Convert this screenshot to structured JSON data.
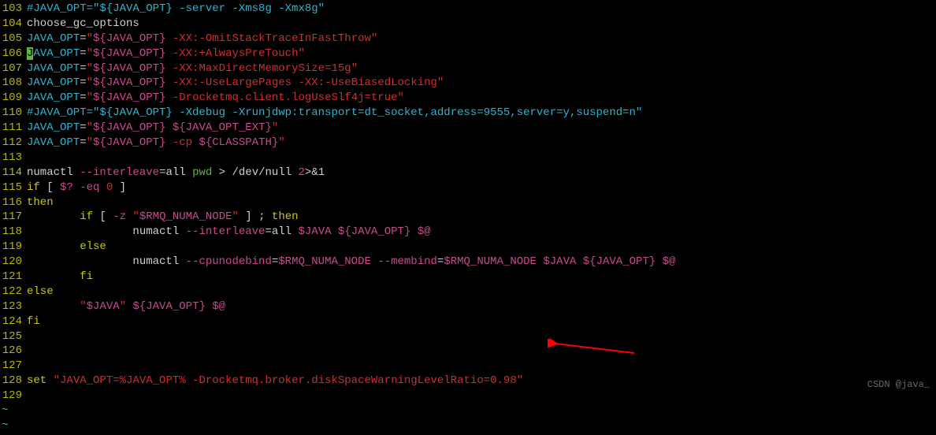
{
  "watermark": "CSDN @java_",
  "tilde": "~",
  "lines": [
    {
      "num": "103",
      "tokens": [
        {
          "t": "#JAVA_OPT=\"${JAVA_OPT} -server -Xms8g -Xmx8g\"",
          "cls": "c-comment"
        }
      ]
    },
    {
      "num": "104",
      "tokens": [
        {
          "t": "choose_gc_options",
          "cls": "c-white"
        }
      ]
    },
    {
      "num": "105",
      "tokens": [
        {
          "t": "JAVA_OPT",
          "cls": "c-cyan"
        },
        {
          "t": "=",
          "cls": "c-white"
        },
        {
          "t": "\"",
          "cls": "c-red"
        },
        {
          "t": "${JAVA_OPT}",
          "cls": "c-magenta"
        },
        {
          "t": " -XX:-OmitStackTraceInFastThrow",
          "cls": "c-red"
        },
        {
          "t": "\"",
          "cls": "c-red"
        }
      ]
    },
    {
      "num": "106",
      "tokens": [
        {
          "t": "J",
          "cls": "cursor-cell"
        },
        {
          "t": "AVA_OPT",
          "cls": "c-cyan"
        },
        {
          "t": "=",
          "cls": "c-white"
        },
        {
          "t": "\"",
          "cls": "c-red"
        },
        {
          "t": "${JAVA_OPT}",
          "cls": "c-magenta"
        },
        {
          "t": " -XX:+AlwaysPreTouch",
          "cls": "c-red"
        },
        {
          "t": "\"",
          "cls": "c-red"
        }
      ]
    },
    {
      "num": "107",
      "tokens": [
        {
          "t": "JAVA_OPT",
          "cls": "c-cyan"
        },
        {
          "t": "=",
          "cls": "c-white"
        },
        {
          "t": "\"",
          "cls": "c-red"
        },
        {
          "t": "${JAVA_OPT}",
          "cls": "c-magenta"
        },
        {
          "t": " -XX:MaxDirectMemorySize=15g",
          "cls": "c-red"
        },
        {
          "t": "\"",
          "cls": "c-red"
        }
      ]
    },
    {
      "num": "108",
      "tokens": [
        {
          "t": "JAVA_OPT",
          "cls": "c-cyan"
        },
        {
          "t": "=",
          "cls": "c-white"
        },
        {
          "t": "\"",
          "cls": "c-red"
        },
        {
          "t": "${JAVA_OPT}",
          "cls": "c-magenta"
        },
        {
          "t": " -XX:-UseLargePages -XX:-UseBiasedLocking",
          "cls": "c-red"
        },
        {
          "t": "\"",
          "cls": "c-red"
        }
      ]
    },
    {
      "num": "109",
      "tokens": [
        {
          "t": "JAVA_OPT",
          "cls": "c-cyan"
        },
        {
          "t": "=",
          "cls": "c-white"
        },
        {
          "t": "\"",
          "cls": "c-red"
        },
        {
          "t": "${JAVA_OPT}",
          "cls": "c-magenta"
        },
        {
          "t": " -Drocketmq.client.logUseSlf4j=true",
          "cls": "c-red"
        },
        {
          "t": "\"",
          "cls": "c-red"
        }
      ]
    },
    {
      "num": "110",
      "tokens": [
        {
          "t": "#JAVA_OPT=\"${JAVA_OPT} -Xdebug -Xrunjdwp:transport=dt_socket,address=9555,server=y,suspend=n\"",
          "cls": "c-comment"
        }
      ]
    },
    {
      "num": "111",
      "tokens": [
        {
          "t": "JAVA_OPT",
          "cls": "c-cyan"
        },
        {
          "t": "=",
          "cls": "c-white"
        },
        {
          "t": "\"",
          "cls": "c-red"
        },
        {
          "t": "${JAVA_OPT} ${JAVA_OPT_EXT}",
          "cls": "c-magenta"
        },
        {
          "t": "\"",
          "cls": "c-red"
        }
      ]
    },
    {
      "num": "112",
      "tokens": [
        {
          "t": "JAVA_OPT",
          "cls": "c-cyan"
        },
        {
          "t": "=",
          "cls": "c-white"
        },
        {
          "t": "\"",
          "cls": "c-red"
        },
        {
          "t": "${JAVA_OPT}",
          "cls": "c-magenta"
        },
        {
          "t": " -cp ",
          "cls": "c-red"
        },
        {
          "t": "${CLASSPATH}",
          "cls": "c-magenta"
        },
        {
          "t": "\"",
          "cls": "c-red"
        }
      ]
    },
    {
      "num": "113",
      "tokens": [
        {
          "t": "",
          "cls": "c-white"
        }
      ]
    },
    {
      "num": "114",
      "tokens": [
        {
          "t": "numactl ",
          "cls": "c-white"
        },
        {
          "t": "--interleave",
          "cls": "c-magenta"
        },
        {
          "t": "=all ",
          "cls": "c-white"
        },
        {
          "t": "pwd",
          "cls": "c-green"
        },
        {
          "t": " > ",
          "cls": "c-white"
        },
        {
          "t": "/dev/null ",
          "cls": "c-white"
        },
        {
          "t": "2",
          "cls": "c-magenta"
        },
        {
          "t": ">&",
          "cls": "c-white"
        },
        {
          "t": "1",
          "cls": "c-white"
        }
      ]
    },
    {
      "num": "115",
      "tokens": [
        {
          "t": "if",
          "cls": "c-yellow"
        },
        {
          "t": " [",
          "cls": "c-white"
        },
        {
          "t": " ",
          "cls": "c-white"
        },
        {
          "t": "$?",
          "cls": "c-magenta"
        },
        {
          "t": " ",
          "cls": "c-white"
        },
        {
          "t": "-eq",
          "cls": "c-magenta"
        },
        {
          "t": " ",
          "cls": "c-white"
        },
        {
          "t": "0",
          "cls": "c-red"
        },
        {
          "t": " ]",
          "cls": "c-white"
        }
      ]
    },
    {
      "num": "116",
      "tokens": [
        {
          "t": "then",
          "cls": "c-yellow"
        }
      ]
    },
    {
      "num": "117",
      "tokens": [
        {
          "t": "        ",
          "cls": "c-white"
        },
        {
          "t": "if",
          "cls": "c-yellow"
        },
        {
          "t": " [",
          "cls": "c-white"
        },
        {
          "t": " ",
          "cls": "c-white"
        },
        {
          "t": "-z",
          "cls": "c-magenta"
        },
        {
          "t": " ",
          "cls": "c-white"
        },
        {
          "t": "\"",
          "cls": "c-red"
        },
        {
          "t": "$RMQ_NUMA_NODE",
          "cls": "c-magenta"
        },
        {
          "t": "\"",
          "cls": "c-red"
        },
        {
          "t": " ] ; ",
          "cls": "c-white"
        },
        {
          "t": "then",
          "cls": "c-yellow"
        }
      ]
    },
    {
      "num": "118",
      "tokens": [
        {
          "t": "                numactl ",
          "cls": "c-white"
        },
        {
          "t": "--interleave",
          "cls": "c-magenta"
        },
        {
          "t": "=all ",
          "cls": "c-white"
        },
        {
          "t": "$JAVA",
          "cls": "c-magenta"
        },
        {
          "t": " ",
          "cls": "c-white"
        },
        {
          "t": "${JAVA_OPT}",
          "cls": "c-magenta"
        },
        {
          "t": " ",
          "cls": "c-white"
        },
        {
          "t": "$@",
          "cls": "c-magenta"
        }
      ]
    },
    {
      "num": "119",
      "tokens": [
        {
          "t": "        ",
          "cls": "c-white"
        },
        {
          "t": "else",
          "cls": "c-yellow"
        }
      ]
    },
    {
      "num": "120",
      "tokens": [
        {
          "t": "                numactl ",
          "cls": "c-white"
        },
        {
          "t": "--cpunodebind",
          "cls": "c-magenta"
        },
        {
          "t": "=",
          "cls": "c-white"
        },
        {
          "t": "$RMQ_NUMA_NODE",
          "cls": "c-magenta"
        },
        {
          "t": " ",
          "cls": "c-white"
        },
        {
          "t": "--membind",
          "cls": "c-magenta"
        },
        {
          "t": "=",
          "cls": "c-white"
        },
        {
          "t": "$RMQ_NUMA_NODE",
          "cls": "c-magenta"
        },
        {
          "t": " ",
          "cls": "c-white"
        },
        {
          "t": "$JAVA",
          "cls": "c-magenta"
        },
        {
          "t": " ",
          "cls": "c-white"
        },
        {
          "t": "${JAVA_OPT}",
          "cls": "c-magenta"
        },
        {
          "t": " ",
          "cls": "c-white"
        },
        {
          "t": "$@",
          "cls": "c-magenta"
        }
      ]
    },
    {
      "num": "121",
      "tokens": [
        {
          "t": "        ",
          "cls": "c-white"
        },
        {
          "t": "fi",
          "cls": "c-yellow"
        }
      ]
    },
    {
      "num": "122",
      "tokens": [
        {
          "t": "else",
          "cls": "c-yellow"
        }
      ]
    },
    {
      "num": "123",
      "tokens": [
        {
          "t": "        ",
          "cls": "c-white"
        },
        {
          "t": "\"",
          "cls": "c-red"
        },
        {
          "t": "$JAVA",
          "cls": "c-magenta"
        },
        {
          "t": "\"",
          "cls": "c-red"
        },
        {
          "t": " ",
          "cls": "c-white"
        },
        {
          "t": "${JAVA_OPT}",
          "cls": "c-magenta"
        },
        {
          "t": " ",
          "cls": "c-white"
        },
        {
          "t": "$@",
          "cls": "c-magenta"
        }
      ]
    },
    {
      "num": "124",
      "tokens": [
        {
          "t": "fi",
          "cls": "c-yellow"
        }
      ]
    },
    {
      "num": "125",
      "tokens": [
        {
          "t": "",
          "cls": "c-white"
        }
      ]
    },
    {
      "num": "126",
      "tokens": [
        {
          "t": "",
          "cls": "c-white"
        }
      ]
    },
    {
      "num": "127",
      "tokens": [
        {
          "t": "",
          "cls": "c-white"
        }
      ]
    },
    {
      "num": "128",
      "tokens": [
        {
          "t": "set",
          "cls": "c-yellow"
        },
        {
          "t": " ",
          "cls": "c-white"
        },
        {
          "t": "\"JAVA_OPT=%JAVA_OPT% -Drocketmq.broker.diskSpaceWarningLevelRatio=0.98\"",
          "cls": "c-red"
        }
      ]
    },
    {
      "num": "129",
      "tokens": [
        {
          "t": "",
          "cls": "c-white"
        }
      ]
    }
  ]
}
